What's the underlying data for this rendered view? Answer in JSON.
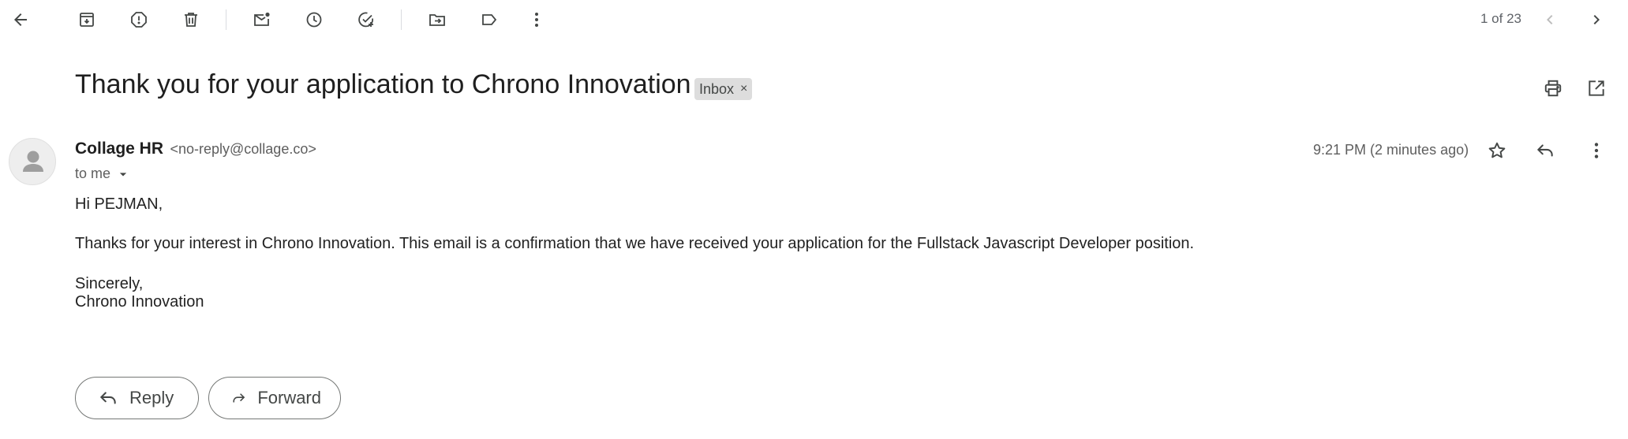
{
  "toolbar": {
    "icons": [
      "back-arrow-icon",
      "archive-icon",
      "report-spam-icon",
      "delete-icon",
      "mark-unread-icon",
      "snooze-icon",
      "add-task-icon",
      "move-to-icon",
      "label-icon",
      "more-vert-icon"
    ],
    "pager_text": "1 of 23"
  },
  "email": {
    "subject": "Thank you for your application to Chrono Innovation",
    "label": "Inbox",
    "label_remove": "×",
    "sender_name": "Collage HR",
    "sender_email": "<no-reply@collage.co>",
    "recipient": "to me",
    "timestamp": "9:21 PM (2 minutes ago)",
    "body": {
      "greeting": "Hi PEJMAN,",
      "paragraph": "Thanks for your interest in Chrono Innovation. This email is a confirmation that we have received your application for the Fullstack Javascript Developer position.",
      "signoff_1": "Sincerely,",
      "signoff_2": "Chrono Innovation"
    }
  },
  "actions": {
    "reply_label": "Reply",
    "forward_label": "Forward"
  },
  "colors": {
    "icon": "#444746",
    "pager_disabled": "#bdbdbd",
    "chip_bg": "#dddddd",
    "border": "#747775"
  }
}
